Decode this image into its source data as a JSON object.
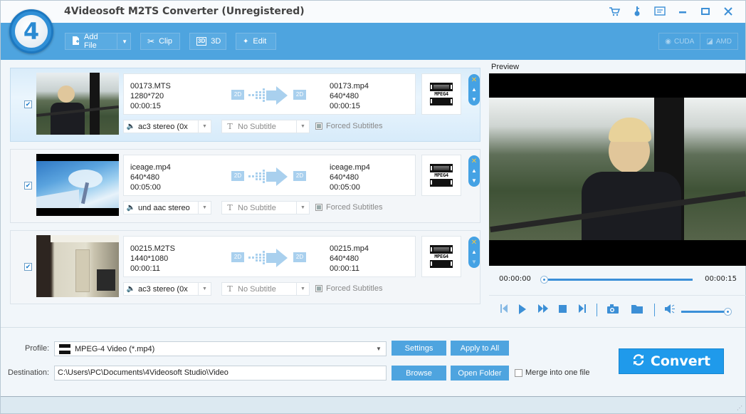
{
  "app": {
    "title": "4Videosoft M2TS Converter (Unregistered)",
    "logo_glyph": "4"
  },
  "window_controls": [
    {
      "name": "cart-icon",
      "glyph": "🛒"
    },
    {
      "name": "key-icon",
      "glyph": "⚷"
    },
    {
      "name": "feedback-icon",
      "glyph": "☰"
    },
    {
      "name": "minimize-icon",
      "glyph": "—"
    },
    {
      "name": "maximize-icon",
      "glyph": "☐"
    },
    {
      "name": "close-icon",
      "glyph": "✕"
    }
  ],
  "toolbar": {
    "add_file": "Add File",
    "clip": "Clip",
    "three_d": "3D",
    "edit": "Edit",
    "cuda": "CUDA",
    "amd": "AMD"
  },
  "files": [
    {
      "checked": true,
      "selected": true,
      "source": {
        "name": "00173.MTS",
        "resolution": "1280*720",
        "duration": "00:00:15"
      },
      "output": {
        "name": "00173.mp4",
        "resolution": "640*480",
        "duration": "00:00:15"
      },
      "mode_in": "2D",
      "mode_out": "2D",
      "format_label": "MPEG4",
      "audio": "ac3 stereo (0x",
      "subtitle": "No Subtitle",
      "forced_subtitles": "Forced Subtitles"
    },
    {
      "checked": true,
      "selected": false,
      "source": {
        "name": "iceage.mp4",
        "resolution": "640*480",
        "duration": "00:05:00"
      },
      "output": {
        "name": "iceage.mp4",
        "resolution": "640*480",
        "duration": "00:05:00"
      },
      "mode_in": "2D",
      "mode_out": "2D",
      "format_label": "MPEG4",
      "audio": "und aac stereo",
      "subtitle": "No Subtitle",
      "forced_subtitles": "Forced Subtitles"
    },
    {
      "checked": true,
      "selected": false,
      "source": {
        "name": "00215.M2TS",
        "resolution": "1440*1080",
        "duration": "00:00:11"
      },
      "output": {
        "name": "00215.mp4",
        "resolution": "640*480",
        "duration": "00:00:11"
      },
      "mode_in": "2D",
      "mode_out": "2D",
      "format_label": "MPEG4",
      "audio": "ac3 stereo (0x",
      "subtitle": "No Subtitle",
      "forced_subtitles": "Forced Subtitles"
    }
  ],
  "preview": {
    "label": "Preview",
    "current_time": "00:00:00",
    "total_time": "00:00:15",
    "progress_fraction": 0.0,
    "volume_fraction": 1.0
  },
  "bottom": {
    "profile_label": "Profile:",
    "profile_value": "MPEG-4 Video (*.mp4)",
    "destination_label": "Destination:",
    "destination_value": "C:\\Users\\PC\\Documents\\4Videosoft Studio\\Video",
    "settings": "Settings",
    "apply_to_all": "Apply to All",
    "browse": "Browse",
    "open_folder": "Open Folder",
    "merge_label": "Merge into one file",
    "merge_checked": false,
    "convert": "Convert"
  },
  "colors": {
    "toolbar_blue": "#4ea4df",
    "accent_blue": "#1f9aeb",
    "icon_blue": "#3c8fd6",
    "remove_x": "#f3c640"
  }
}
